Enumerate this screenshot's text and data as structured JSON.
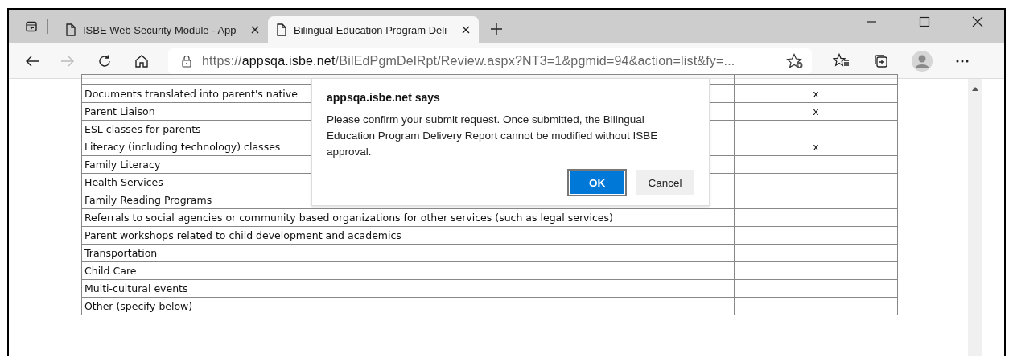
{
  "tabs": [
    {
      "title": "ISBE Web Security Module - App",
      "selected": false
    },
    {
      "title": "Bilingual Education Program Deli",
      "selected": true
    }
  ],
  "address_bar": {
    "scheme": "https://",
    "host": "appsqa.isbe.net",
    "path": "/BilEdPgmDelRpt/Review.aspx?NT3=1&pgmid=94&action=list&fy=..."
  },
  "table": {
    "rows": [
      {
        "service": "Documents translated into parent's native",
        "column_2": "x"
      },
      {
        "service": "Parent Liaison",
        "column_2": "x"
      },
      {
        "service": "ESL classes for parents"
      },
      {
        "service": "Literacy (including technology) classes",
        "column_2": "x"
      },
      {
        "service": "Family Literacy"
      },
      {
        "service": "Health Services"
      },
      {
        "service": "Family Reading Programs"
      },
      {
        "service": "Referrals to social agencies or community based organizations for other services (such as legal services)"
      },
      {
        "service": "Parent workshops related to child development and academics"
      },
      {
        "service": "Transportation"
      },
      {
        "service": "Child Care"
      },
      {
        "service": "Multi-cultural events"
      },
      {
        "service": "Other (specify below)"
      }
    ]
  },
  "dialog": {
    "title": "appsqa.isbe.net says",
    "message": "Please confirm your submit request. Once submitted, the Bilingual Education Program Delivery Report cannot be modified without ISBE approval.",
    "buttons": [
      {
        "label": "OK",
        "kind": "primary"
      },
      {
        "label": "Cancel",
        "kind": "secondary"
      }
    ]
  }
}
